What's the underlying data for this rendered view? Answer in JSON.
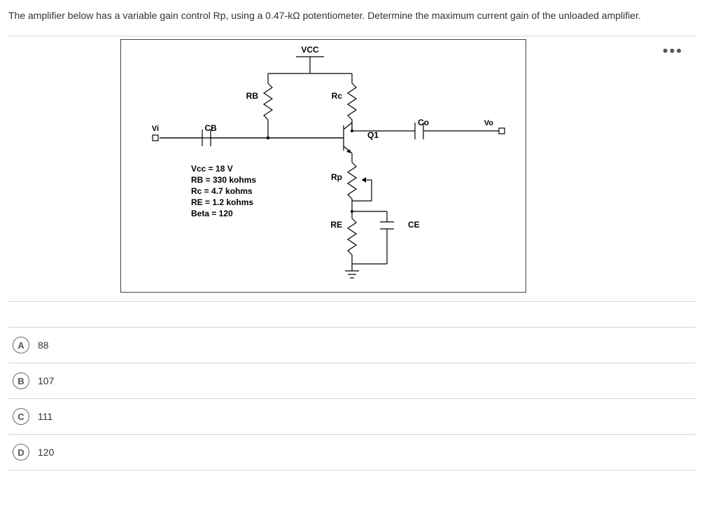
{
  "question": "The amplifier below has a variable gain control Rp, using a 0.47-kΩ potentiometer. Determine the maximum current gain of the unloaded amplifier.",
  "diagram": {
    "vcc": "VCC",
    "rb": "RB",
    "rc": "Rc",
    "cb": "CB",
    "vi": "Vi",
    "co": "Co",
    "vo": "Vo",
    "q1": "Q1",
    "rp": "Rp",
    "re": "RE",
    "ce": "CE",
    "params": [
      "Vcc = 18 V",
      "RB = 330 kohms",
      "Rc = 4.7 kohms",
      "RE = 1.2 kohms",
      "Beta = 120"
    ]
  },
  "options": [
    {
      "letter": "A",
      "text": "88"
    },
    {
      "letter": "B",
      "text": "107"
    },
    {
      "letter": "C",
      "text": "111"
    },
    {
      "letter": "D",
      "text": "120"
    }
  ]
}
